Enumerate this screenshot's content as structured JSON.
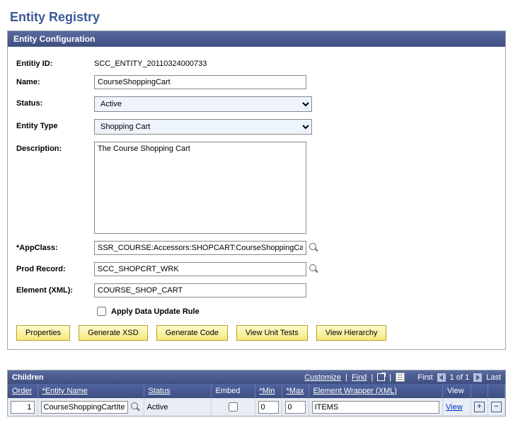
{
  "page_title": "Entity Registry",
  "entity_config": {
    "panel_title": "Entity Configuration",
    "labels": {
      "entity_id": "Entitiy ID:",
      "name": "Name:",
      "status": "Status:",
      "entity_type": "Entity Type",
      "description": "Description:",
      "app_class": "*AppClass:",
      "prod_record": "Prod Record:",
      "element_xml": "Element (XML):",
      "apply_rule": "Apply Data Update Rule"
    },
    "values": {
      "entity_id": "SCC_ENTITY_20110324000733",
      "name": "CourseShoppingCart",
      "status": "Active",
      "entity_type": "Shopping Cart",
      "description": "The Course Shopping Cart",
      "app_class": "SSR_COURSE:Accessors:SHOPCART:CourseShoppingCart",
      "prod_record": "SCC_SHOPCRT_WRK",
      "element_xml": "COURSE_SHOP_CART"
    },
    "buttons": {
      "properties": "Properties",
      "generate_xsd": "Generate XSD",
      "generate_code": "Generate Code",
      "view_unit_tests": "View Unit Tests",
      "view_hierarchy": "View Hierarchy"
    }
  },
  "children": {
    "panel_title": "Children",
    "nav": {
      "customize": "Customize",
      "find": "Find",
      "first": "First",
      "counter": "1 of 1",
      "last": "Last"
    },
    "headers": {
      "order": "Order",
      "entity_name": "*Entity Name",
      "status": "Status",
      "embed": "Embed",
      "min": "*Min",
      "max": "*Max",
      "element_wrapper": "Element Wrapper (XML)",
      "view": "View"
    },
    "rows": [
      {
        "order": "1",
        "entity_name": "CourseShoppingCartItem",
        "status": "Active",
        "embed": false,
        "min": "0",
        "max": "0",
        "element_wrapper": "ITEMS",
        "view": "View"
      }
    ]
  }
}
